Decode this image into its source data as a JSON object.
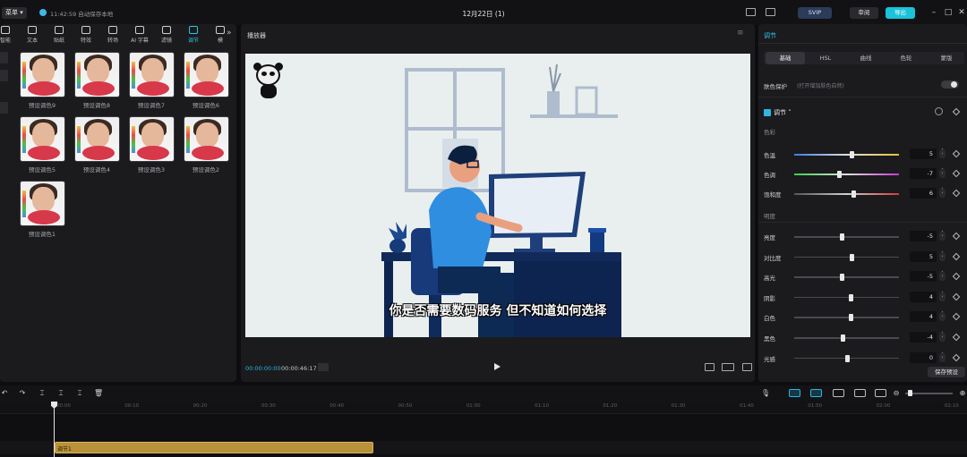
{
  "header": {
    "menu_label": "菜单",
    "autosave": "11:42:59 自动保存本地",
    "project_title": "12月22日 (1)",
    "svip_label": "SVIP",
    "review_label": "审阅",
    "export_label": "导出"
  },
  "toolbar": {
    "items": [
      {
        "label": "智能",
        "icon": "sparkle-icon"
      },
      {
        "label": "文本",
        "icon": "text-icon"
      },
      {
        "label": "贴纸",
        "icon": "sticker-icon"
      },
      {
        "label": "特效",
        "icon": "effects-icon"
      },
      {
        "label": "转场",
        "icon": "transition-icon"
      },
      {
        "label": "AI 字幕",
        "icon": "ai-caption-icon"
      },
      {
        "label": "滤镜",
        "icon": "filter-icon"
      },
      {
        "label": "调节",
        "icon": "adjust-icon"
      },
      {
        "label": "模",
        "icon": "template-icon"
      }
    ]
  },
  "presets": [
    {
      "label": "预设调色9"
    },
    {
      "label": "预设调色8"
    },
    {
      "label": "预设调色7"
    },
    {
      "label": "预设调色6"
    },
    {
      "label": "预设调色5"
    },
    {
      "label": "预设调色4"
    },
    {
      "label": "预设调色3"
    },
    {
      "label": "预设调色2"
    },
    {
      "label": "预设调色1"
    }
  ],
  "player": {
    "title": "播放器",
    "subtitle": "你是否需要数码服务 但不知道如何选择",
    "current_time": "00:00:00:00",
    "total_time": "00:00:46:17"
  },
  "adjust_panel": {
    "tab": "调节",
    "subtabs": [
      "基础",
      "HSL",
      "曲线",
      "色轮",
      "蒙版"
    ],
    "active_subtab": "基础",
    "color_protect_label": "肤色保护",
    "color_protect_hint": "(打开增加肤色自然)",
    "color_protect_on": true,
    "section_title": "调节",
    "group_color": "色彩",
    "group_light": "明度",
    "color_sliders": [
      {
        "label": "色温",
        "value": "5",
        "level": 0.55
      },
      {
        "label": "色调",
        "value": "-7",
        "level": 0.43
      },
      {
        "label": "饱和度",
        "value": "6",
        "level": 0.56
      }
    ],
    "light_sliders": [
      {
        "label": "亮度",
        "value": "-5",
        "level": 0.45
      },
      {
        "label": "对比度",
        "value": "5",
        "level": 0.55
      },
      {
        "label": "高光",
        "value": "-5",
        "level": 0.45
      },
      {
        "label": "阴影",
        "value": "4",
        "level": 0.54
      },
      {
        "label": "白色",
        "value": "4",
        "level": 0.54
      },
      {
        "label": "黑色",
        "value": "-4",
        "level": 0.46
      },
      {
        "label": "光感",
        "value": "0",
        "level": 0.5
      }
    ],
    "save_preset": "保存预设"
  },
  "timeline": {
    "ticks": [
      "00:00",
      "00:10",
      "00:20",
      "00:30",
      "00:40",
      "00:50",
      "01:00",
      "01:10",
      "01:20",
      "01:30",
      "01:40",
      "01:50",
      "02:00",
      "02:10"
    ],
    "clip_label": "调节1"
  }
}
